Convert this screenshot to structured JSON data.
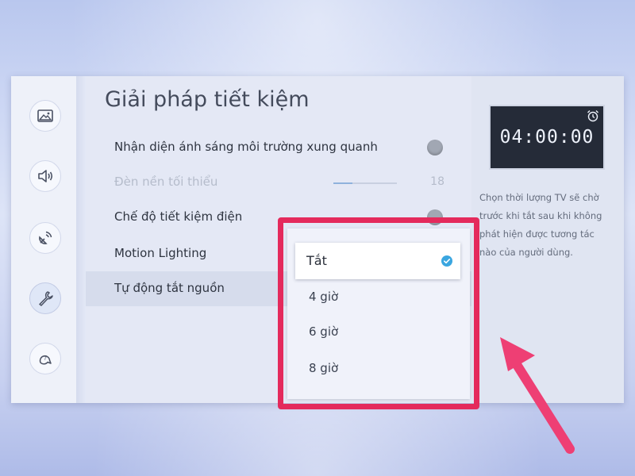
{
  "sidebar": {
    "items": [
      {
        "icon": "picture-icon"
      },
      {
        "icon": "sound-icon"
      },
      {
        "icon": "broadcast-icon"
      },
      {
        "icon": "wrench-icon",
        "active": true
      },
      {
        "icon": "support-icon"
      }
    ]
  },
  "main": {
    "title": "Giải pháp tiết kiệm",
    "items": [
      {
        "label": "Nhận diện ánh sáng môi trường xung quanh"
      },
      {
        "label": "Đèn nền tối thiểu",
        "value": "18",
        "slider_fraction": 0.3,
        "disabled": true
      },
      {
        "label": "Chế độ tiết kiệm điện"
      },
      {
        "label": "Motion Lighting"
      },
      {
        "label": "Tự động tắt nguồn"
      }
    ]
  },
  "dropdown": {
    "options": [
      {
        "label": "Tắt",
        "selected": true
      },
      {
        "label": "4 giờ"
      },
      {
        "label": "6 giờ"
      },
      {
        "label": "8 giờ"
      }
    ]
  },
  "info": {
    "timer": "04:00:00",
    "description": "Chọn thời lượng TV sẽ chờ trước khi tắt sau khi không phát hiện được tương tác nào của người dùng."
  },
  "colors": {
    "highlight": "#e42a5c",
    "check": "#3aa6e0",
    "arrow": "#ee3f74"
  }
}
